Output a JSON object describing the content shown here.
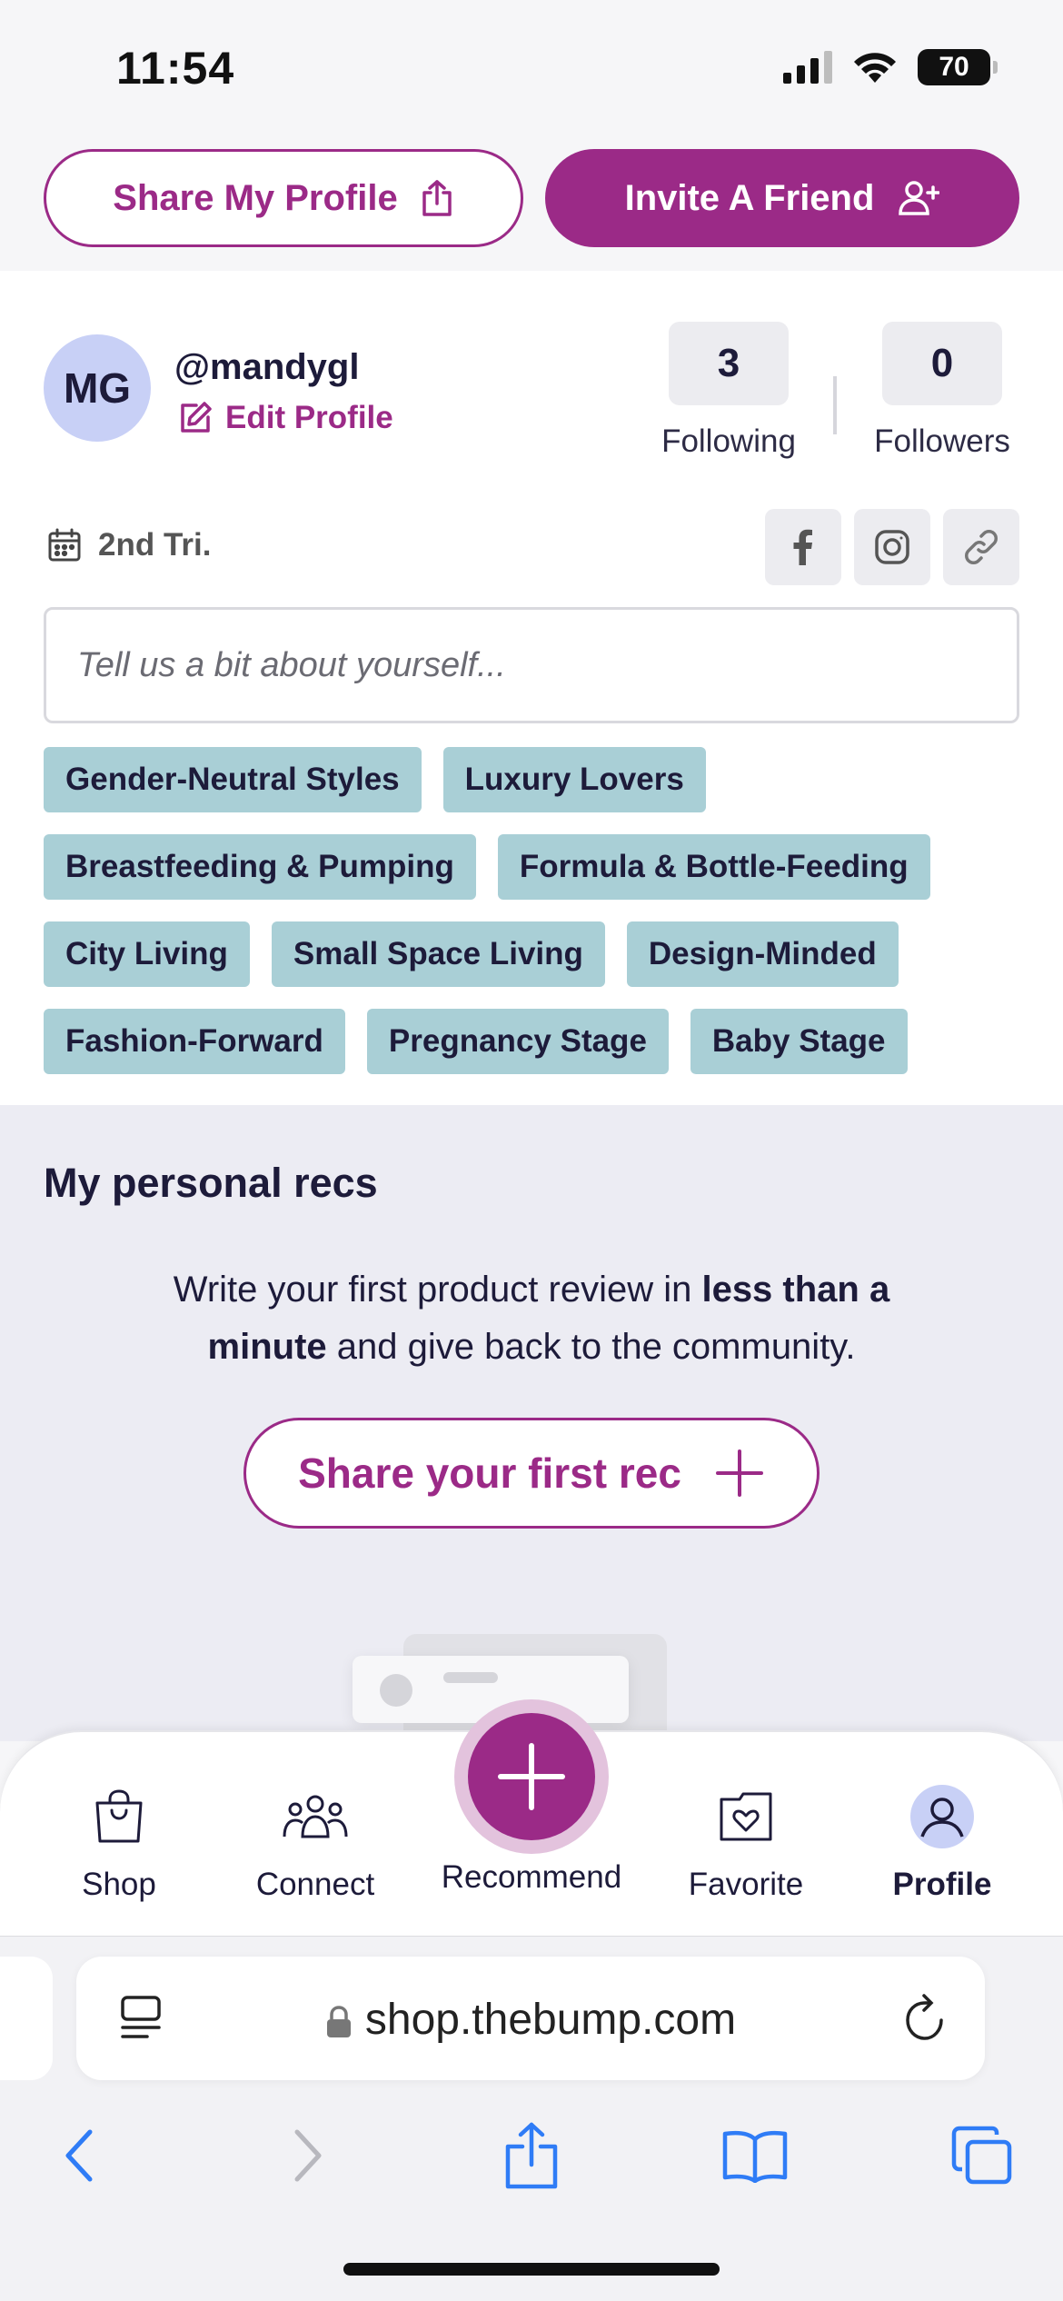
{
  "status_bar": {
    "time": "11:54",
    "battery": "70"
  },
  "top_actions": {
    "share_profile": "Share My Profile",
    "invite_friend": "Invite A Friend"
  },
  "profile": {
    "initials": "MG",
    "username": "@mandygl",
    "edit_label": "Edit Profile",
    "following_count": "3",
    "following_label": "Following",
    "followers_count": "0",
    "followers_label": "Followers",
    "trimester": "2nd Tri.",
    "bio_placeholder": "Tell us a bit about yourself...",
    "tags": [
      "Gender-Neutral Styles",
      "Luxury Lovers",
      "Breastfeeding & Pumping",
      "Formula & Bottle-Feeding",
      "City Living",
      "Small Space Living",
      "Design-Minded",
      "Fashion-Forward",
      "Pregnancy Stage",
      "Baby Stage"
    ]
  },
  "recs": {
    "title": "My personal recs",
    "text_part1": "Write your first product review in ",
    "text_bold": "less than a minute",
    "text_part2": " and give back to the community.",
    "button": "Share your first rec"
  },
  "bottom_nav": {
    "shop": "Shop",
    "connect": "Connect",
    "recommend": "Recommend",
    "favorite": "Favorite",
    "profile": "Profile"
  },
  "browser": {
    "url": "shop.thebump.com"
  },
  "colors": {
    "brand": "#9b2a87",
    "tag_bg": "#a9cfd6",
    "avatar_bg": "#c8d0f6",
    "ios_blue": "#2f7cf6"
  }
}
